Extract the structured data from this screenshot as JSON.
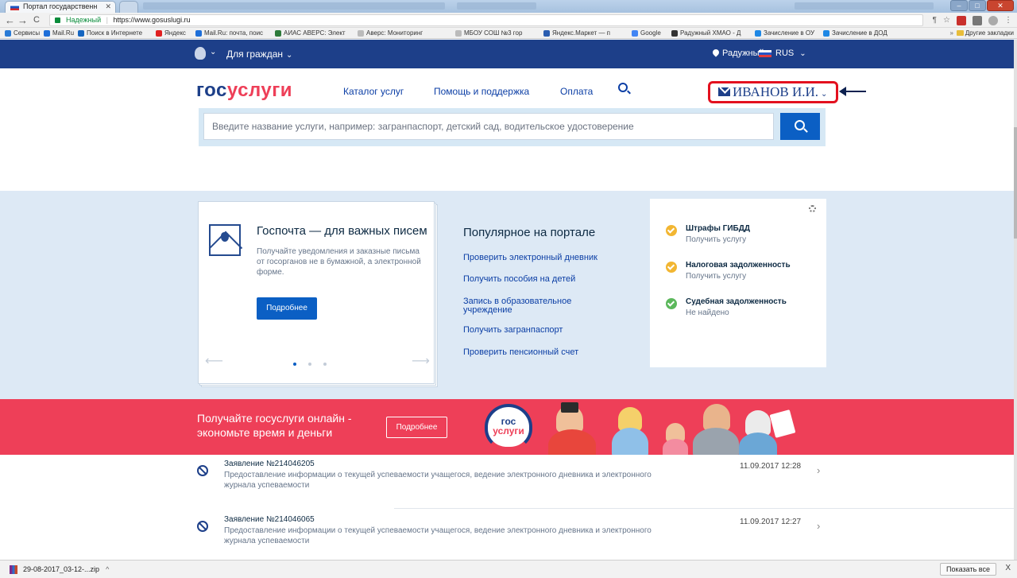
{
  "browser": {
    "active_tab": "Портал государственн",
    "inactive_tab": "",
    "address": {
      "secure_label": "Надежный",
      "url": "https://www.gosuslugi.ru"
    },
    "bookmarks": [
      "Сервисы",
      "Mail.Ru",
      "Поиск в Интернете",
      "Яндекс",
      "Mail.Ru: почта, поис",
      "АИАС АВЕРС: Элект",
      "Аверс: Мониторинг",
      "МБОУ СОШ №3 гор",
      "Яндекс.Маркет — п",
      "Google",
      "Радужный ХМАО - Д",
      "Зачисление в ОУ",
      "Зачисление в ДОД"
    ],
    "bookmarks_more": "»",
    "other_bookmarks": "Другие закладки"
  },
  "topbar": {
    "for_citizens": "Для граждан",
    "region": "Радужный",
    "language": "RUS"
  },
  "header": {
    "logo_gos": "гос",
    "logo_uslugi": "услуги",
    "nav": [
      "Каталог услуг",
      "Помощь и поддержка",
      "Оплата"
    ],
    "user_name": "ИВАНОВ И.И.",
    "search_placeholder": "Введите название услуги, например: загранпаспорт, детский сад, водительское удостоверение"
  },
  "promo_card": {
    "title": "Госпочта — для важных писем",
    "text": "Получайте уведомления и заказные письма от госорганов не в бумажной, а электронной форме.",
    "button": "Подробнее"
  },
  "popular": {
    "title": "Популярное на портале",
    "links": [
      "Проверить электронный дневник",
      "Получить пособия на детей",
      "Запись в образовательное учреждение",
      "Получить загранпаспорт",
      "Проверить пенсионный счет"
    ]
  },
  "info": {
    "items": [
      {
        "title": "Штрафы ГИБДД",
        "status": "Получить услугу",
        "color": "#f2b632"
      },
      {
        "title": "Налоговая задолженность",
        "status": "Получить услугу",
        "color": "#f2b632"
      },
      {
        "title": "Судебная задолженность",
        "status": "Не найдено",
        "color": "#5cb85c"
      }
    ]
  },
  "banner": {
    "text": "Получайте госуслуги онлайн - экономьте время и деньги",
    "button": "Подробнее",
    "badge_top": "гос",
    "badge_bottom": "услуги"
  },
  "applications": [
    {
      "title": "Заявление №214046205",
      "desc": "Предоставление информации о текущей успеваемости учащегося, ведение электронного дневника и электронного журнала успеваемости",
      "date": "11.09.2017 12:28"
    },
    {
      "title": "Заявление №214046065",
      "desc": "Предоставление информации о текущей успеваемости учащегося, ведение электронного дневника и электронного журнала успеваемости",
      "date": "11.09.2017 12:27"
    }
  ],
  "shelf": {
    "file": "29-08-2017_03-12-...zip",
    "show_all": "Показать все",
    "close": "X"
  },
  "colors": {
    "brand_blue": "#1d3f89",
    "brand_red": "#ee3f58",
    "link_blue": "#0b3ea5",
    "button_blue": "#0b5fc4",
    "annotation_red": "#e3111f"
  }
}
